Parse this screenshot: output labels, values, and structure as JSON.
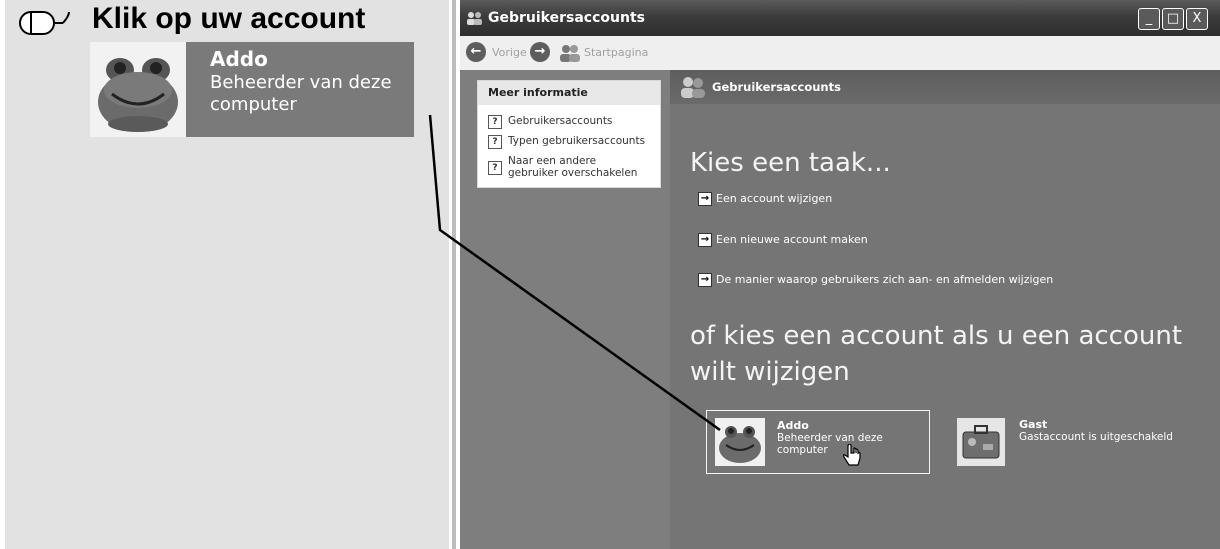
{
  "instruction": {
    "title": "Klik op uw account",
    "callout_name": "Addo",
    "callout_desc": "Beheerder van deze computer",
    "icon": "mouse-icon"
  },
  "window": {
    "title": "Gebruikersaccounts",
    "buttons": {
      "minimize": "_",
      "maximize": "□",
      "close": "X"
    },
    "toolbar": {
      "back": "Vorige",
      "home": "Startpagina"
    }
  },
  "side": {
    "header": "Meer informatie",
    "items": [
      "Gebruikersaccounts",
      "Typen gebruikersaccounts",
      "Naar een andere gebruiker overschakelen"
    ]
  },
  "main": {
    "header": "Gebruikersaccounts",
    "heading_task": "Kies een taak...",
    "tasks": [
      "Een account wijzigen",
      "Een nieuwe account maken",
      "De manier waarop gebruikers zich aan- en afmelden wijzigen"
    ],
    "heading_account": "of kies een account als u een account wilt wijzigen",
    "accounts": [
      {
        "name": "Addo",
        "desc": "Beheerder van deze computer"
      },
      {
        "name": "Gast",
        "desc": "Gastaccount is uitgeschakeld"
      }
    ]
  }
}
